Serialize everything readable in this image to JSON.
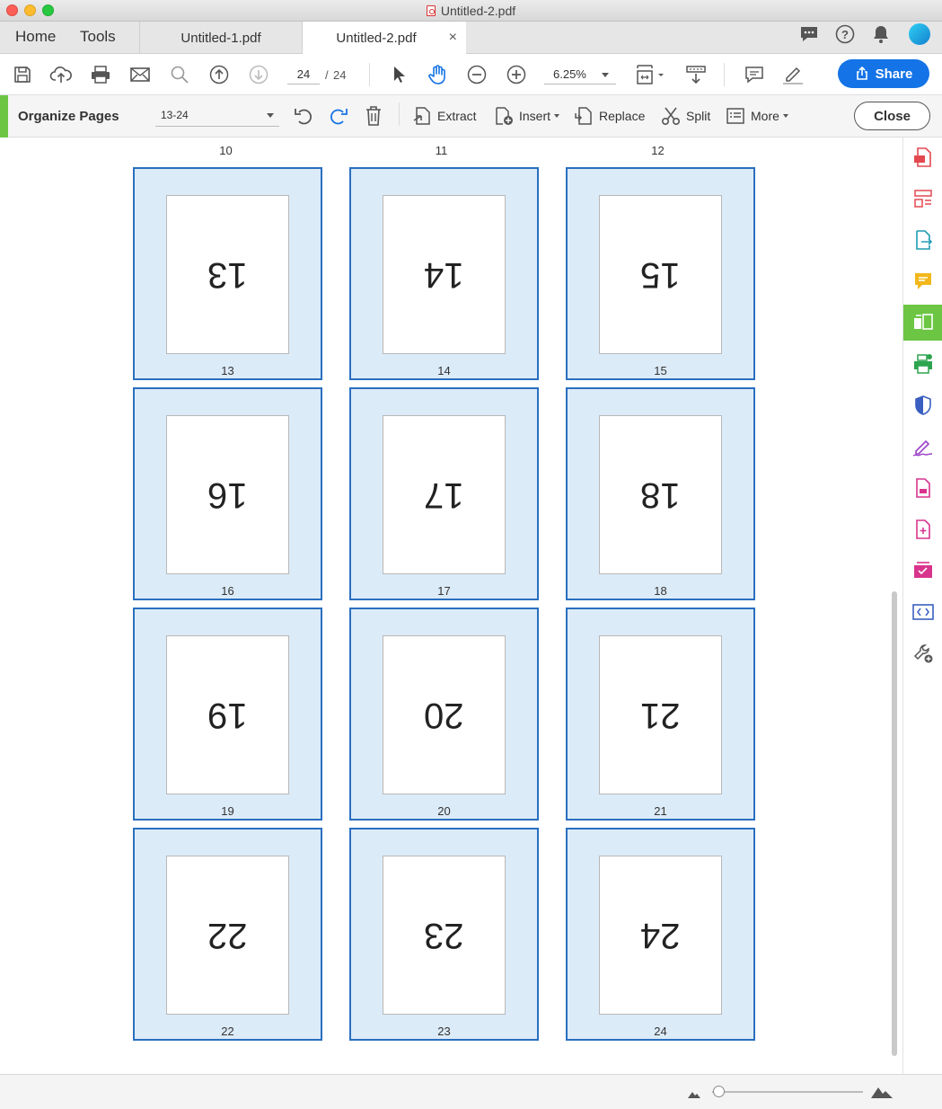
{
  "window": {
    "title": "Untitled-2.pdf"
  },
  "nav": {
    "home": "Home",
    "tools": "Tools"
  },
  "tabs": [
    {
      "label": "Untitled-1.pdf"
    },
    {
      "label": "Untitled-2.pdf",
      "close": "×"
    }
  ],
  "toolbar": {
    "current_page": "24",
    "page_sep": "/",
    "total_pages": "24",
    "zoom": "6.25%",
    "share_label": "Share"
  },
  "organize": {
    "title": "Organize Pages",
    "range": "13-24",
    "extract": "Extract",
    "insert": "Insert",
    "replace": "Replace",
    "split": "Split",
    "more": "More",
    "close": "Close"
  },
  "prev_row_labels": [
    "10",
    "11",
    "12"
  ],
  "thumbnails": [
    {
      "number": "13",
      "caption": "13"
    },
    {
      "number": "14",
      "caption": "14"
    },
    {
      "number": "15",
      "caption": "15"
    },
    {
      "number": "16",
      "caption": "16"
    },
    {
      "number": "17",
      "caption": "17"
    },
    {
      "number": "18",
      "caption": "18"
    },
    {
      "number": "19",
      "caption": "19"
    },
    {
      "number": "20",
      "caption": "20"
    },
    {
      "number": "21",
      "caption": "21"
    },
    {
      "number": "22",
      "caption": "22"
    },
    {
      "number": "23",
      "caption": "23"
    },
    {
      "number": "24",
      "caption": "24"
    }
  ],
  "colors": {
    "accent_blue": "#1473e6",
    "organize_green": "#6cc644",
    "thumb_border": "#2a6fbf",
    "thumb_fill": "#dcebf8"
  },
  "right_panel_icons": [
    "create-pdf-icon",
    "edit-pdf-icon",
    "export-pdf-icon",
    "comment-icon",
    "organize-pages-icon",
    "scan-icon",
    "protect-icon",
    "fill-sign-icon",
    "document-icon",
    "enhance-icon",
    "compare-icon",
    "bracket-icon",
    "more-tools-icon"
  ]
}
